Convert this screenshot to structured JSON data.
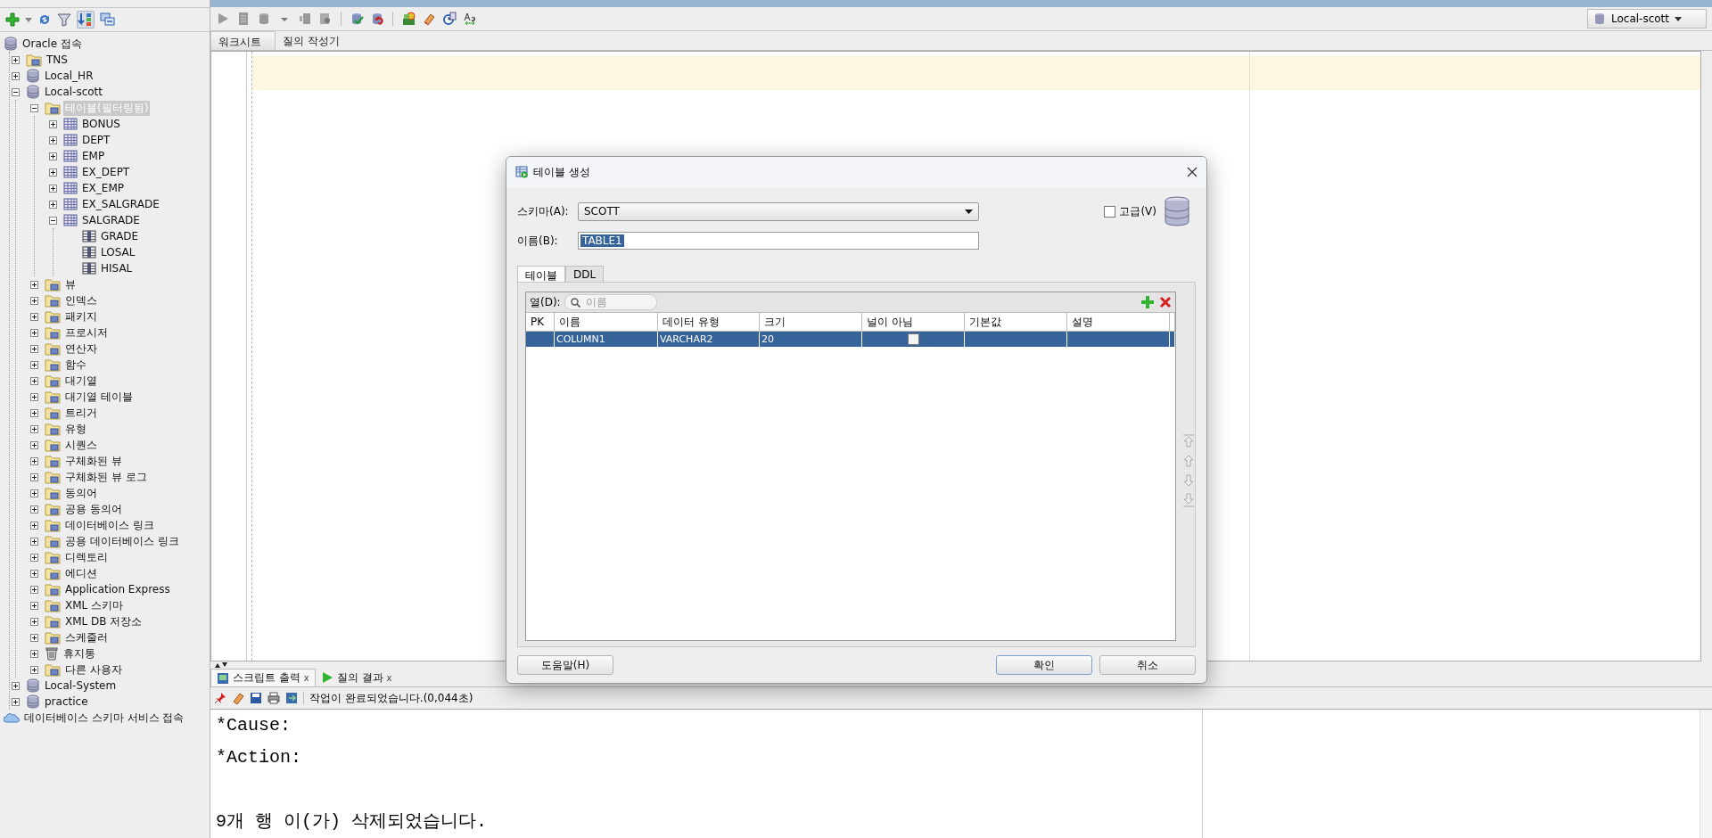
{
  "navigator": {
    "tree": [
      {
        "label": "Oracle 접속",
        "kind": "connection",
        "selected": false,
        "children": [
          {
            "label": "TNS",
            "kind": "folder",
            "expanded": false,
            "selected": false
          },
          {
            "label": "Local_HR",
            "kind": "connection",
            "expanded": false,
            "selected": false
          },
          {
            "label": "Local-scott",
            "kind": "connection",
            "expanded": true,
            "selected": false,
            "children": [
              {
                "label": "테이블(필터링됨)",
                "kind": "folder",
                "expanded": true,
                "selected": true,
                "children": [
                  {
                    "label": "BONUS",
                    "kind": "table",
                    "expanded": false,
                    "selected": false
                  },
                  {
                    "label": "DEPT",
                    "kind": "table",
                    "expanded": false,
                    "selected": false
                  },
                  {
                    "label": "EMP",
                    "kind": "table",
                    "expanded": false,
                    "selected": false
                  },
                  {
                    "label": "EX_DEPT",
                    "kind": "table",
                    "expanded": false,
                    "selected": false
                  },
                  {
                    "label": "EX_EMP",
                    "kind": "table",
                    "expanded": false,
                    "selected": false
                  },
                  {
                    "label": "EX_SALGRADE",
                    "kind": "table",
                    "expanded": false,
                    "selected": false
                  },
                  {
                    "label": "SALGRADE",
                    "kind": "table",
                    "expanded": true,
                    "selected": false,
                    "children": [
                      {
                        "label": "GRADE",
                        "kind": "column",
                        "selected": false
                      },
                      {
                        "label": "LOSAL",
                        "kind": "column",
                        "selected": false
                      },
                      {
                        "label": "HISAL",
                        "kind": "column",
                        "selected": false
                      }
                    ]
                  }
                ]
              },
              {
                "label": "뷰",
                "kind": "folder",
                "expanded": false,
                "selected": false
              },
              {
                "label": "인덱스",
                "kind": "folder",
                "expanded": false,
                "selected": false
              },
              {
                "label": "패키지",
                "kind": "folder",
                "expanded": false,
                "selected": false
              },
              {
                "label": "프로시저",
                "kind": "folder",
                "expanded": false,
                "selected": false
              },
              {
                "label": "연산자",
                "kind": "folder",
                "expanded": false,
                "selected": false
              },
              {
                "label": "함수",
                "kind": "folder",
                "expanded": false,
                "selected": false
              },
              {
                "label": "대기열",
                "kind": "folder",
                "expanded": false,
                "selected": false
              },
              {
                "label": "대기열 테이블",
                "kind": "folder",
                "expanded": false,
                "selected": false
              },
              {
                "label": "트리거",
                "kind": "folder",
                "expanded": false,
                "selected": false
              },
              {
                "label": "유형",
                "kind": "folder",
                "expanded": false,
                "selected": false
              },
              {
                "label": "시퀀스",
                "kind": "folder",
                "expanded": false,
                "selected": false
              },
              {
                "label": "구체화된 뷰",
                "kind": "folder",
                "expanded": false,
                "selected": false
              },
              {
                "label": "구체화된 뷰 로그",
                "kind": "folder",
                "expanded": false,
                "selected": false
              },
              {
                "label": "동의어",
                "kind": "folder",
                "expanded": false,
                "selected": false
              },
              {
                "label": "공용 동의어",
                "kind": "folder",
                "expanded": false,
                "selected": false
              },
              {
                "label": "데이터베이스 링크",
                "kind": "folder",
                "expanded": false,
                "selected": false
              },
              {
                "label": "공용 데이터베이스 링크",
                "kind": "folder",
                "expanded": false,
                "selected": false
              },
              {
                "label": "디렉토리",
                "kind": "folder",
                "expanded": false,
                "selected": false
              },
              {
                "label": "에디션",
                "kind": "folder",
                "expanded": false,
                "selected": false
              },
              {
                "label": "Application Express",
                "kind": "folder",
                "expanded": false,
                "selected": false
              },
              {
                "label": "XML 스키마",
                "kind": "folder",
                "expanded": false,
                "selected": false
              },
              {
                "label": "XML DB 저장소",
                "kind": "folder",
                "expanded": false,
                "selected": false
              },
              {
                "label": "스케줄러",
                "kind": "folder",
                "expanded": false,
                "selected": false
              },
              {
                "label": "휴지통",
                "kind": "trash",
                "expanded": false,
                "selected": false
              },
              {
                "label": "다른 사용자",
                "kind": "folder",
                "expanded": false,
                "selected": false
              }
            ]
          },
          {
            "label": "Local-System",
            "kind": "connection",
            "expanded": false,
            "selected": false
          },
          {
            "label": "practice",
            "kind": "connection",
            "expanded": false,
            "selected": false
          }
        ]
      },
      {
        "label": "데이터베이스 스키마 서비스 접속",
        "kind": "cloud",
        "selected": false
      }
    ]
  },
  "editor": {
    "connection": "Local-scott",
    "tabs": [
      {
        "label": "워크시트",
        "selected": true
      },
      {
        "label": "질의 작성기",
        "selected": false
      }
    ]
  },
  "output": {
    "tabs": [
      {
        "label": "스크립트 출력",
        "close": "x",
        "selected": true
      },
      {
        "label": "질의 결과",
        "close": "x",
        "selected": false
      }
    ],
    "status": "작업이 완료되었습니다.(0,044초)",
    "lines": [
      "*Cause:",
      "*Action:",
      "9개 행 이(가) 삭제되었습니다."
    ]
  },
  "dialog": {
    "title": "테이블 생성",
    "schema": {
      "label": "스키마(A):",
      "value": "SCOTT"
    },
    "advanced": {
      "label": "고급(V)",
      "checked": false
    },
    "name": {
      "label": "이름(B):",
      "value": "TABLE1"
    },
    "tabs": [
      {
        "label": "테이블",
        "selected": true
      },
      {
        "label": "DDL",
        "selected": false
      }
    ],
    "columns_filter": {
      "label": "열(D):",
      "placeholder": "이름"
    },
    "table": {
      "columns": [
        "PK",
        "이름",
        "데이터 유형",
        "크기",
        "널이 아님",
        "기본값",
        "설명"
      ],
      "rows": [
        {
          "selected": true,
          "name": "COLUMN1",
          "data_type": "VARCHAR2",
          "size": "20",
          "not_null": false
        }
      ]
    },
    "buttons": [
      {
        "label": "도움말(H)",
        "default": false
      },
      {
        "label": "확인",
        "default": true
      },
      {
        "label": "취소",
        "default": false
      }
    ]
  }
}
